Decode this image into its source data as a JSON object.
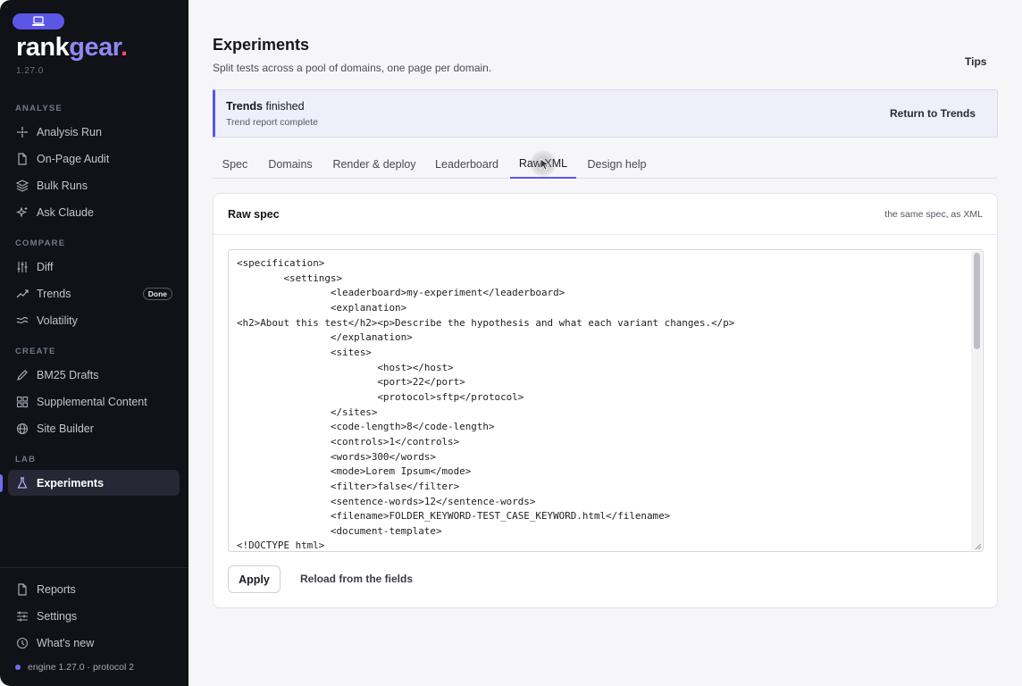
{
  "brand": {
    "name_part1": "rank",
    "name_part2": "gear",
    "name_dot": ".",
    "version": "1.27.0",
    "colors": {
      "accent": "#5b57e6",
      "accent_light": "#8c89f0",
      "dot": "#ef4f6a",
      "sidebar_bg": "#111118"
    }
  },
  "sidebar": {
    "sections": {
      "analyse": "ANALYSE",
      "compare": "COMPARE",
      "create": "CREATE",
      "lab": "LAB"
    },
    "items": {
      "analysis_run": {
        "label": "Analysis Run",
        "icon": "sparkle-icon"
      },
      "on_page_audit": {
        "label": "On-Page Audit",
        "icon": "document-icon"
      },
      "bulk_runs": {
        "label": "Bulk Runs",
        "icon": "layers-icon"
      },
      "ask_claude": {
        "label": "Ask Claude",
        "icon": "stars-icon"
      },
      "diff": {
        "label": "Diff",
        "icon": "sliders-icon"
      },
      "trends": {
        "label": "Trends",
        "icon": "trend-icon",
        "badge": "Done"
      },
      "volatility": {
        "label": "Volatility",
        "icon": "wave-icon"
      },
      "bm25_drafts": {
        "label": "BM25 Drafts",
        "icon": "pencil-icon"
      },
      "supplemental_content": {
        "label": "Supplemental Content",
        "icon": "grid-icon"
      },
      "site_builder": {
        "label": "Site Builder",
        "icon": "globe-icon"
      },
      "experiments": {
        "label": "Experiments",
        "icon": "flask-icon",
        "active": true
      },
      "reports": {
        "label": "Reports",
        "icon": "document-icon"
      },
      "settings": {
        "label": "Settings",
        "icon": "sliders-horizontal-icon"
      },
      "whats_new": {
        "label": "What's new",
        "icon": "clock-icon"
      }
    },
    "engine_status": "engine 1.27.0 · protocol 2"
  },
  "header": {
    "title": "Experiments",
    "subtitle": "Split tests across a pool of domains, one page per domain.",
    "tips": "Tips"
  },
  "banner": {
    "title_bold": "Trends",
    "title_rest": " finished",
    "subtitle": "Trend report complete",
    "action": "Return to Trends"
  },
  "tabs": {
    "spec": "Spec",
    "domains": "Domains",
    "render_deploy": "Render & deploy",
    "leaderboard": "Leaderboard",
    "raw_xml": "Raw XML",
    "design_help": "Design help",
    "active": "raw_xml"
  },
  "raw_spec": {
    "title": "Raw spec",
    "note": "the same spec, as XML",
    "xml": "<specification>\n\t<settings>\n\t\t<leaderboard>my-experiment</leaderboard>\n\t\t<explanation>\n<h2>About this test</h2><p>Describe the hypothesis and what each variant changes.</p>\n\t\t</explanation>\n\t\t<sites>\n\t\t\t<host></host>\n\t\t\t<port>22</port>\n\t\t\t<protocol>sftp</protocol>\n\t\t</sites>\n\t\t<code-length>8</code-length>\n\t\t<controls>1</controls>\n\t\t<words>300</words>\n\t\t<mode>Lorem Ipsum</mode>\n\t\t<filter>false</filter>\n\t\t<sentence-words>12</sentence-words>\n\t\t<filename>FOLDER_KEYWORD-TEST_CASE_KEYWORD.html</filename>\n\t\t<document-template>\n<!DOCTYPE html>",
    "apply": "Apply",
    "reload": "Reload from the fields"
  }
}
